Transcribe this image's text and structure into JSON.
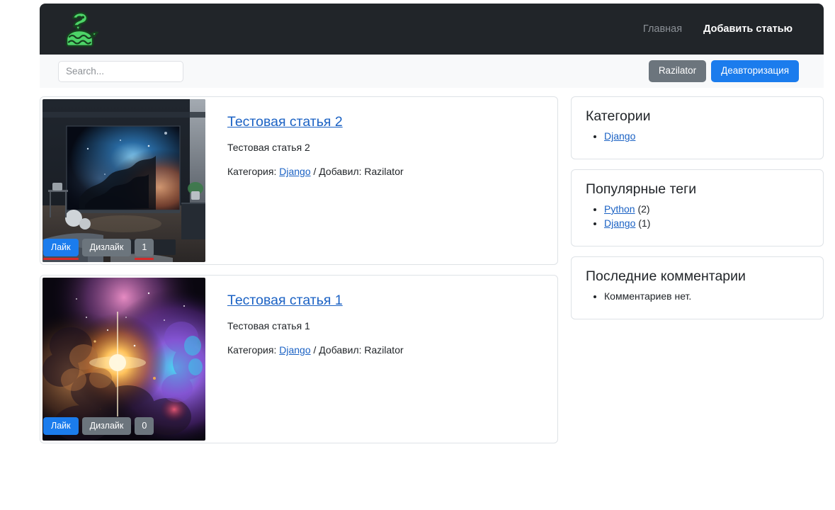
{
  "navbar": {
    "logo_icon": "snake-logo-icon",
    "links": [
      {
        "label": "Главная",
        "active": false
      },
      {
        "label": "Добавить статью",
        "active": true
      }
    ]
  },
  "searchbar": {
    "placeholder": "Search...",
    "value": "",
    "user_button": "Razilator",
    "logout_button": "Деавторизация"
  },
  "articles": [
    {
      "title": "Тестовая статья 2",
      "text": "Тестовая статья 2",
      "meta_prefix": "Категория: ",
      "category": "Django",
      "meta_middle": " / Добавил: ",
      "author": "Razilator",
      "like_label": "Лайк",
      "dislike_label": "Дизлайк",
      "count": "1",
      "like_marked": true,
      "count_marked": true,
      "image": "bedroom-nebula-poster"
    },
    {
      "title": "Тестовая статья 1",
      "text": "Тестовая статья 1",
      "meta_prefix": "Категория: ",
      "category": "Django",
      "meta_middle": " / Добавил: ",
      "author": "Razilator",
      "like_label": "Лайк",
      "dislike_label": "Дизлайк",
      "count": "0",
      "like_marked": false,
      "count_marked": false,
      "image": "colorful-nebula-starburst"
    }
  ],
  "sidebar": {
    "categories": {
      "title": "Категории",
      "items": [
        {
          "label": "Django"
        }
      ]
    },
    "tags": {
      "title": "Популярные теги",
      "items": [
        {
          "label": "Python",
          "count": "(2)"
        },
        {
          "label": "Django",
          "count": "(1)"
        }
      ]
    },
    "comments": {
      "title": "Последние комментарии",
      "items": [
        {
          "label": "Комментариев нет."
        }
      ]
    }
  },
  "colors": {
    "navbar_bg": "#212529",
    "primary": "#1b7ced",
    "secondary": "#6c757d",
    "link": "#1b62c4",
    "mark": "#d42a2a",
    "logo_green": "#4dd468"
  }
}
